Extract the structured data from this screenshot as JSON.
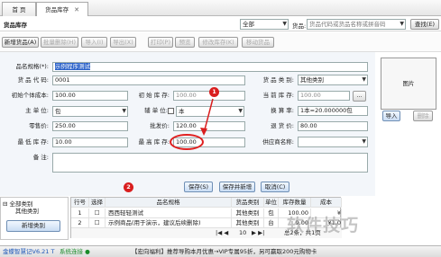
{
  "tabs": [
    {
      "label": "首  页"
    },
    {
      "label": "货品库存"
    }
  ],
  "header": {
    "title": "货品库存",
    "category_select": "全部",
    "search_label": "货品:",
    "search_placeholder": "货品代码或货品名称或拼音码",
    "search_button": "查找(E)"
  },
  "toolbar": {
    "buttons": [
      {
        "label": "新增货品(A)",
        "enabled": true
      },
      {
        "label": "批量删除(H)",
        "enabled": false
      },
      {
        "label": "导入(I)",
        "enabled": false
      },
      {
        "label": "导出(X)",
        "enabled": false
      },
      {
        "label": "打印(P)",
        "enabled": false
      },
      {
        "label": "预览",
        "enabled": false
      },
      {
        "label": "修改库存(K)",
        "enabled": false
      },
      {
        "label": "移动货品",
        "enabled": false
      }
    ]
  },
  "form": {
    "name_label": "品名规格(*):",
    "name_value": "示例程序测试",
    "code_label": "货 品 代 码:",
    "code_value": "0001",
    "category_label": "货 品 类 别:",
    "category_value": "其他类别",
    "init_cost_label": "初始个体成本:",
    "init_cost_value": "100.00",
    "init_stock_label": "初 始 库 存:",
    "init_stock_value": "100.00",
    "cur_stock_label": "当 前 库 存:",
    "cur_stock_value": "100.00",
    "unit_label": "主    单    位:",
    "unit_value": "包",
    "sub_unit_label": "辅 单 位:",
    "sub_unit_value": "本",
    "convert_label": "换 算 率:",
    "convert_value": "1本=20.000000包",
    "retail_label": "零售价:",
    "retail_value": "250.00",
    "wholesale_label": "批发价:",
    "wholesale_value": "120.00",
    "return_label": "退 货 价:",
    "return_value": "80.00",
    "min_stock_label": "最 低 库 存:",
    "min_stock_value": "10.00",
    "max_stock_label": "最 高 库 存:",
    "max_stock_value": "100.00",
    "supplier_label": "供应商名称:",
    "supplier_value": "",
    "remark_label": "备        注:",
    "remark_value": "",
    "photo_label": "图片",
    "import_label": "导入",
    "delete_label": "删除"
  },
  "actions": {
    "save": "保存(S)",
    "save_new": "保存并新增",
    "cancel": "取消(C)"
  },
  "annotations": {
    "step1": "1",
    "step2": "2"
  },
  "tree": {
    "root": "全部类别",
    "child": "其他类别",
    "footer": "新增类别"
  },
  "table": {
    "headers": [
      "行号",
      "选择",
      "品名规格",
      "货品类别",
      "单位",
      "库存数量",
      "成本"
    ],
    "rows": [
      [
        "1",
        "",
        "西西轻轻测试",
        "其他类别",
        "包",
        "100.00",
        "¥"
      ],
      [
        "2",
        "",
        "示例商品(用于演示，建议后续删除)",
        "其他类别",
        "台",
        "9.00",
        "¥1,0"
      ]
    ],
    "footer_count": "10",
    "footer_page": "总2条，共1页"
  },
  "status": {
    "app": "金蝶智慧记V6.21 T",
    "net": "系统连接 ●",
    "promo": "【宏向福利】推荐导购本月优惠→VIP专属95折，另可赢取200元购物卡"
  },
  "watermark": "软件技巧",
  "colors": {
    "annotation_red": "#d91e1e",
    "form_bg": "#f3f6fa",
    "accent_blue": "#1a55b8"
  }
}
